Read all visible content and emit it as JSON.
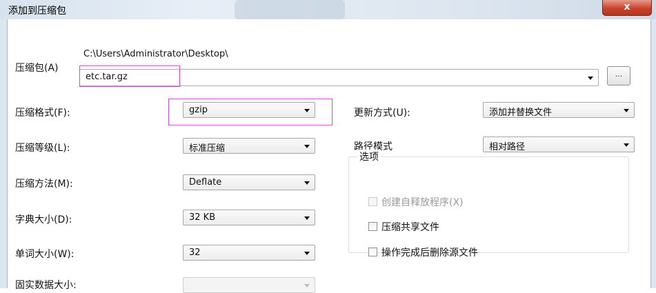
{
  "window": {
    "title": "添加到压缩包",
    "close_label": "x"
  },
  "archive": {
    "label": "压缩包(A)",
    "path": "C:\\Users\\Administrator\\Desktop\\",
    "filename": "etc.tar.gz",
    "browse_label": "..."
  },
  "left_fields": [
    {
      "label": "压缩格式(F):",
      "value": "gzip"
    },
    {
      "label": "压缩等级(L):",
      "value": "标准压缩"
    },
    {
      "label": "压缩方法(M):",
      "value": "Deflate"
    },
    {
      "label": "字典大小(D):",
      "value": "32 KB"
    },
    {
      "label": "单词大小(W):",
      "value": "32"
    },
    {
      "label": "固实数据大小:",
      "value": ""
    }
  ],
  "right_fields": [
    {
      "label": "更新方式(U):",
      "value": "添加并替换文件"
    },
    {
      "label": "路径模式",
      "value": "相对路径"
    }
  ],
  "options": {
    "title": "选项",
    "items": [
      {
        "label": "创建自释放程序(X)",
        "checked": false,
        "disabled": true
      },
      {
        "label": "压缩共享文件",
        "checked": false,
        "disabled": false
      },
      {
        "label": "操作完成后删除源文件",
        "checked": false,
        "disabled": false
      }
    ]
  }
}
